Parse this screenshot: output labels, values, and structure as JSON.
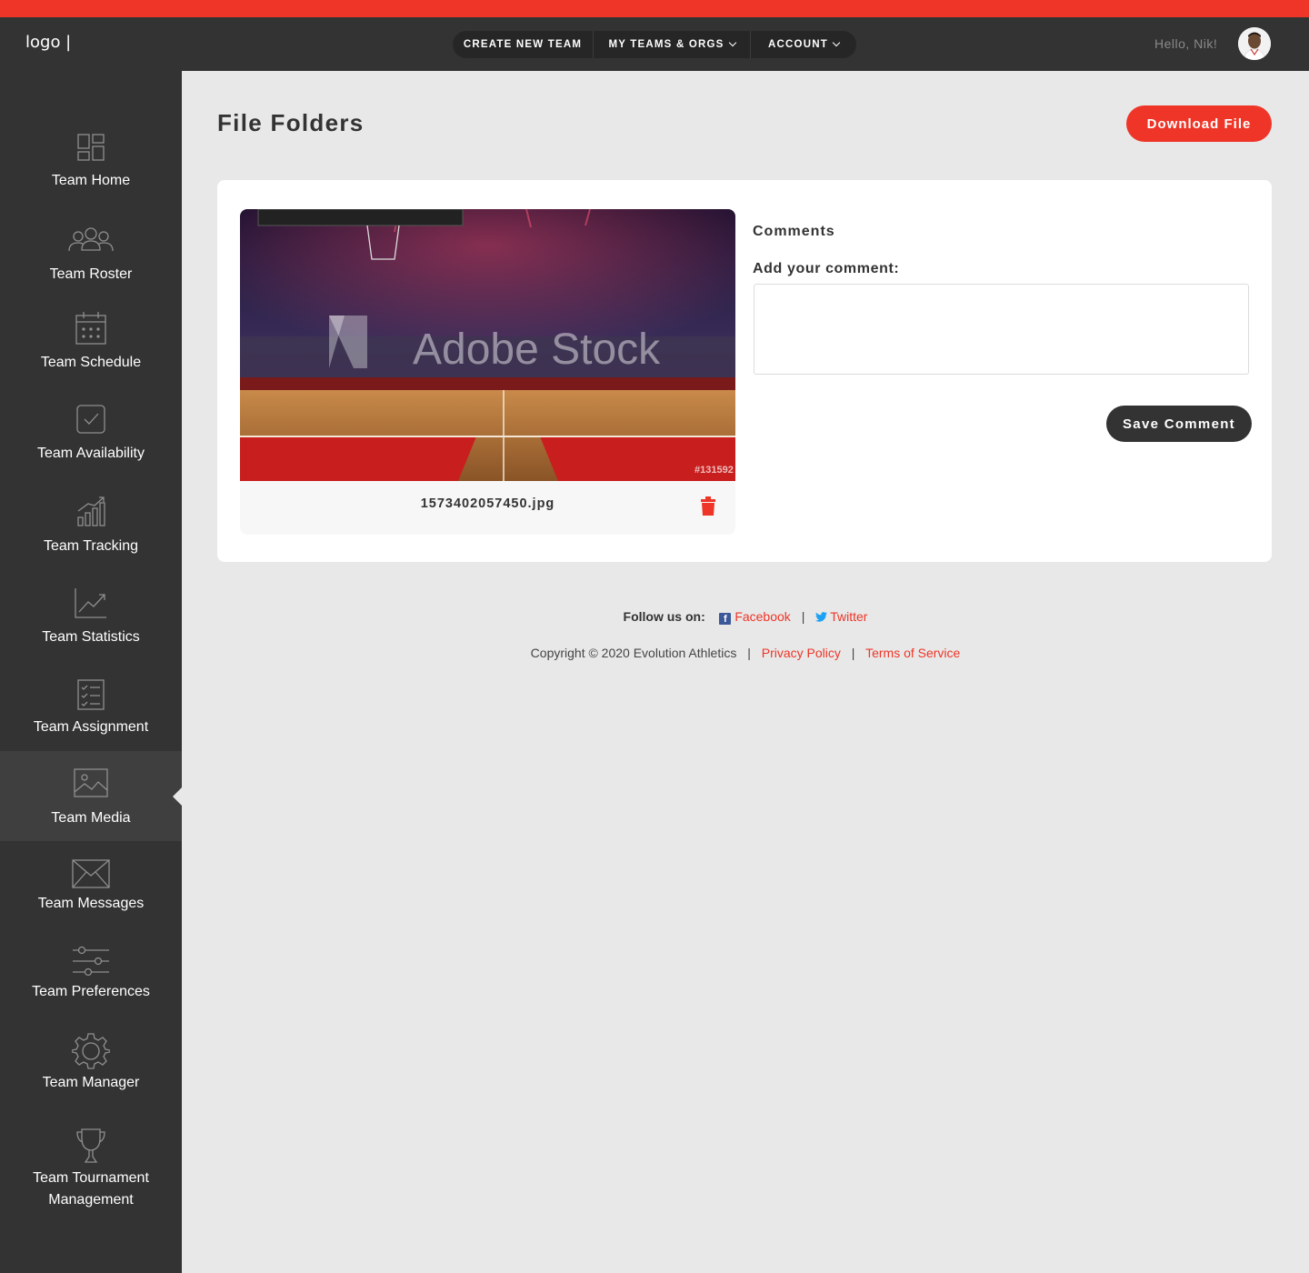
{
  "header": {
    "logo": "logo |",
    "nav": {
      "create_team": "CREATE NEW TEAM",
      "my_teams": "MY TEAMS & ORGS",
      "account": "ACCOUNT"
    },
    "greeting": "Hello, Nik!"
  },
  "sidebar": {
    "items": [
      {
        "label": "Team Home",
        "icon": "dashboard-icon"
      },
      {
        "label": "Team Roster",
        "icon": "users-icon"
      },
      {
        "label": "Team Schedule",
        "icon": "calendar-icon"
      },
      {
        "label": "Team Availability",
        "icon": "checkbox-icon"
      },
      {
        "label": "Team Tracking",
        "icon": "bar-chart-icon"
      },
      {
        "label": "Team Statistics",
        "icon": "trend-chart-icon"
      },
      {
        "label": "Team Assignment",
        "icon": "checklist-icon"
      },
      {
        "label": "Team Media",
        "icon": "image-icon",
        "active": true
      },
      {
        "label": "Team Messages",
        "icon": "envelope-icon"
      },
      {
        "label": "Team Preferences",
        "icon": "sliders-icon"
      },
      {
        "label": "Team Manager",
        "icon": "gear-icon"
      },
      {
        "label": "Team Tournament",
        "label2": "Management",
        "icon": "trophy-icon"
      }
    ]
  },
  "main": {
    "title": "File Folders",
    "download_label": "Download File",
    "file": {
      "name": "1573402057450.jpg",
      "watermark": "Adobe Stock",
      "stock_id": "#131592"
    },
    "comments": {
      "title": "Comments",
      "add_label": "Add your comment:",
      "value": "",
      "save_label": "Save Comment"
    }
  },
  "footer": {
    "follow_label": "Follow us on:",
    "facebook": "Facebook",
    "twitter": "Twitter",
    "copyright": "Copyright © 2020 Evolution Athletics",
    "privacy": "Privacy Policy",
    "terms": "Terms of Service"
  },
  "colors": {
    "accent": "#ee3527",
    "header_bg": "#333333",
    "page_bg": "#e8e8e8"
  }
}
